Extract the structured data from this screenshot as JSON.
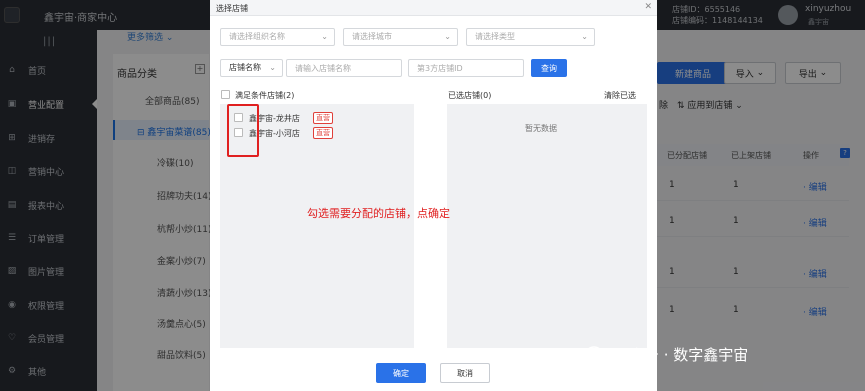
{
  "app": {
    "title": "鑫宇宙·商家中心"
  },
  "header": {
    "store_id": "店铺ID：6555146",
    "store_code": "店铺编码：1148144134",
    "user_name": "xinyuzhou",
    "user_sub": "鑫宇宙"
  },
  "sidebar": {
    "items": [
      {
        "label": "首页",
        "icon": "home-icon"
      },
      {
        "label": "营业配置",
        "icon": "shop-icon"
      },
      {
        "label": "进销存",
        "icon": "inventory-icon"
      },
      {
        "label": "营销中心",
        "icon": "marketing-icon"
      },
      {
        "label": "报表中心",
        "icon": "report-icon"
      },
      {
        "label": "订单管理",
        "icon": "order-icon"
      },
      {
        "label": "图片管理",
        "icon": "image-icon"
      },
      {
        "label": "权限管理",
        "icon": "permission-icon"
      },
      {
        "label": "会员管理",
        "icon": "member-icon"
      },
      {
        "label": "其他",
        "icon": "other-icon"
      }
    ]
  },
  "background": {
    "filter_link": "更多筛选 ⌄",
    "category_header": "商品分类",
    "categories": [
      {
        "label": "全部商品(85)"
      },
      {
        "label": "鑫宇宙菜谱(85)"
      },
      {
        "label": "冷碟(10)"
      },
      {
        "label": "招牌功夫(14)"
      },
      {
        "label": "杭帮小炒(11)"
      },
      {
        "label": "金案小炒(7)"
      },
      {
        "label": "清蔬小炒(13)"
      },
      {
        "label": "汤羹点心(5)"
      },
      {
        "label": "甜品饮料(5)"
      }
    ],
    "new_product": "新建商品",
    "import": "导入",
    "export": "导出",
    "action_remove": "除",
    "action_apply": "应用到店铺",
    "table_headers": [
      "已分配店铺",
      "已上架店铺",
      "操作"
    ],
    "rows": [
      {
        "assigned": "1",
        "listed": "1",
        "op": "编辑"
      },
      {
        "assigned": "1",
        "listed": "1",
        "op": "编辑"
      },
      {
        "assigned": "1",
        "listed": "1",
        "op": "编辑"
      },
      {
        "assigned": "1",
        "listed": "1",
        "op": "编辑"
      }
    ]
  },
  "modal": {
    "title": "选择店铺",
    "org_placeholder": "请选择组织名称",
    "city_placeholder": "请选择城市",
    "type_placeholder": "请选择类型",
    "name_select": "店铺名称",
    "name_placeholder": "请输入店铺名称",
    "third_id_placeholder": "第3方店铺ID",
    "query": "查询",
    "left_header": "满足条件店铺(2)",
    "right_header": "已选店铺(0)",
    "clear": "清除已选",
    "empty": "暂无数据",
    "stores": [
      {
        "name": "鑫宇宙-龙井店",
        "tag": "直营"
      },
      {
        "name": "鑫宇宙-小河店",
        "tag": "直营"
      }
    ],
    "ok": "确定",
    "cancel": "取消"
  },
  "annotation": "勾选需要分配的店铺，点确定",
  "watermark": "公众号 · 数字鑫宇宙",
  "colors": {
    "primary": "#2a72e8",
    "annotation": "#e02020",
    "sidebar_bg": "#2b2f36"
  }
}
